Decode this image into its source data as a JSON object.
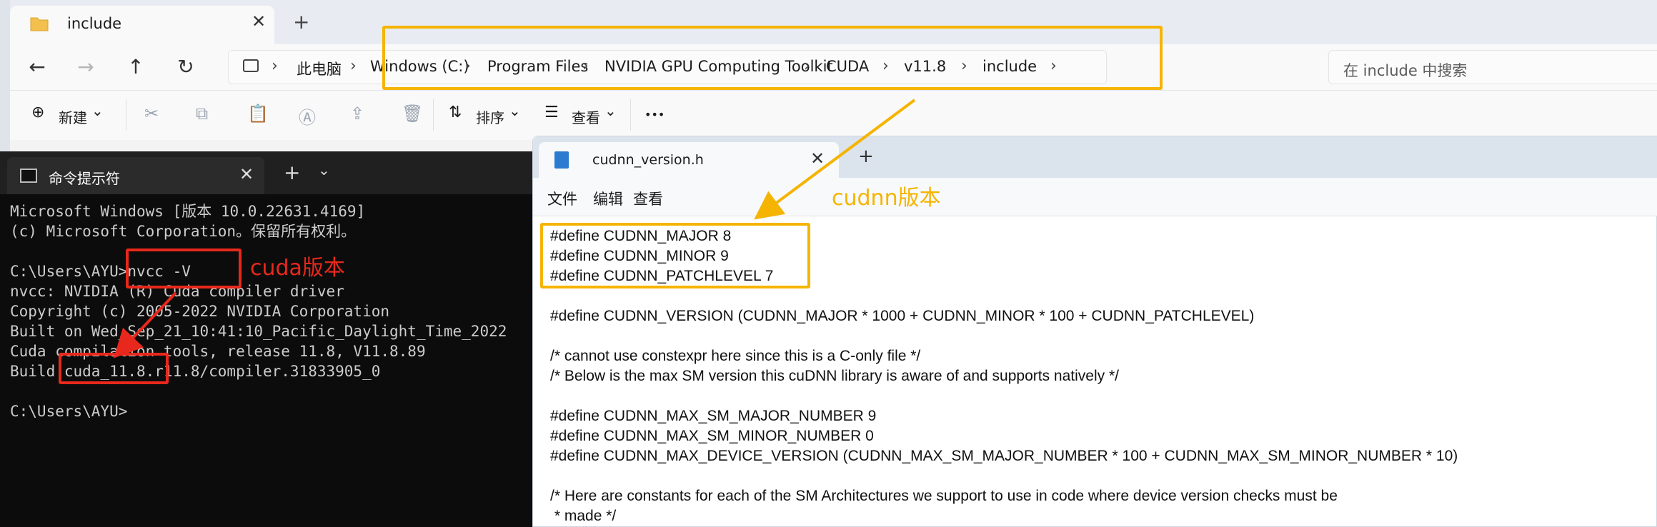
{
  "explorer": {
    "tab_title": "include",
    "close_glyph": "✕",
    "new_tab_glyph": "+",
    "nav": {
      "back": "←",
      "forward": "→",
      "up": "↑",
      "refresh": "↻"
    },
    "breadcrumb": [
      "此电脑",
      "Windows (C:)",
      "Program Files",
      "NVIDIA GPU Computing Toolkit",
      "CUDA",
      "v11.8",
      "include"
    ],
    "chevron": "›",
    "search_placeholder": "在 include 中搜索",
    "toolbar": {
      "new_label": "新建",
      "sort_label": "排序",
      "view_label": "查看",
      "more_glyph": "•••",
      "new_glyph": "⊕",
      "sort_glyph": "⇅",
      "view_glyph": "☰",
      "dropdown_glyph": "⌄",
      "cut_glyph": "✂",
      "copy_glyph": "⧉",
      "paste_glyph": "📋",
      "rename_glyph": "Ⓐ",
      "share_glyph": "⇪",
      "delete_glyph": "🗑"
    }
  },
  "terminal": {
    "tab_title": "命令提示符",
    "close_glyph": "✕",
    "plus_glyph": "+",
    "dropdown_glyph": "⌄",
    "lines": [
      "Microsoft Windows [版本 10.0.22631.4169]",
      "(c) Microsoft Corporation。保留所有权利。",
      "",
      "C:\\Users\\AYU>nvcc -V",
      "nvcc: NVIDIA (R) Cuda compiler driver",
      "Copyright (c) 2005-2022 NVIDIA Corporation",
      "Built on Wed_Sep_21_10:41:10_Pacific_Daylight_Time_2022",
      "Cuda compilation tools, release 11.8, V11.8.89",
      "Build cuda_11.8.r11.8/compiler.31833905_0",
      "",
      "C:\\Users\\AYU>"
    ]
  },
  "notepad": {
    "tab_title": "cudnn_version.h",
    "close_glyph": "✕",
    "plus_glyph": "+",
    "menu": [
      "文件",
      "编辑",
      "查看"
    ],
    "lines": [
      "#define CUDNN_MAJOR 8",
      "#define CUDNN_MINOR 9",
      "#define CUDNN_PATCHLEVEL 7",
      "",
      "#define CUDNN_VERSION (CUDNN_MAJOR * 1000 + CUDNN_MINOR * 100 + CUDNN_PATCHLEVEL)",
      "",
      "/* cannot use constexpr here since this is a C-only file */",
      "/* Below is the max SM version this cuDNN library is aware of and supports natively */",
      "",
      "#define CUDNN_MAX_SM_MAJOR_NUMBER 9",
      "#define CUDNN_MAX_SM_MINOR_NUMBER 0",
      "#define CUDNN_MAX_DEVICE_VERSION (CUDNN_MAX_SM_MAJOR_NUMBER * 100 + CUDNN_MAX_SM_MINOR_NUMBER * 10)",
      "",
      "/* Here are constants for each of the SM Architectures we support to use in code where device version checks must be",
      " * made */"
    ]
  },
  "annotations": {
    "cuda_label": "cuda版本",
    "cudnn_label": "cudnn版本",
    "cuda_color": "#e8281c",
    "cudnn_color": "#f5b400"
  }
}
